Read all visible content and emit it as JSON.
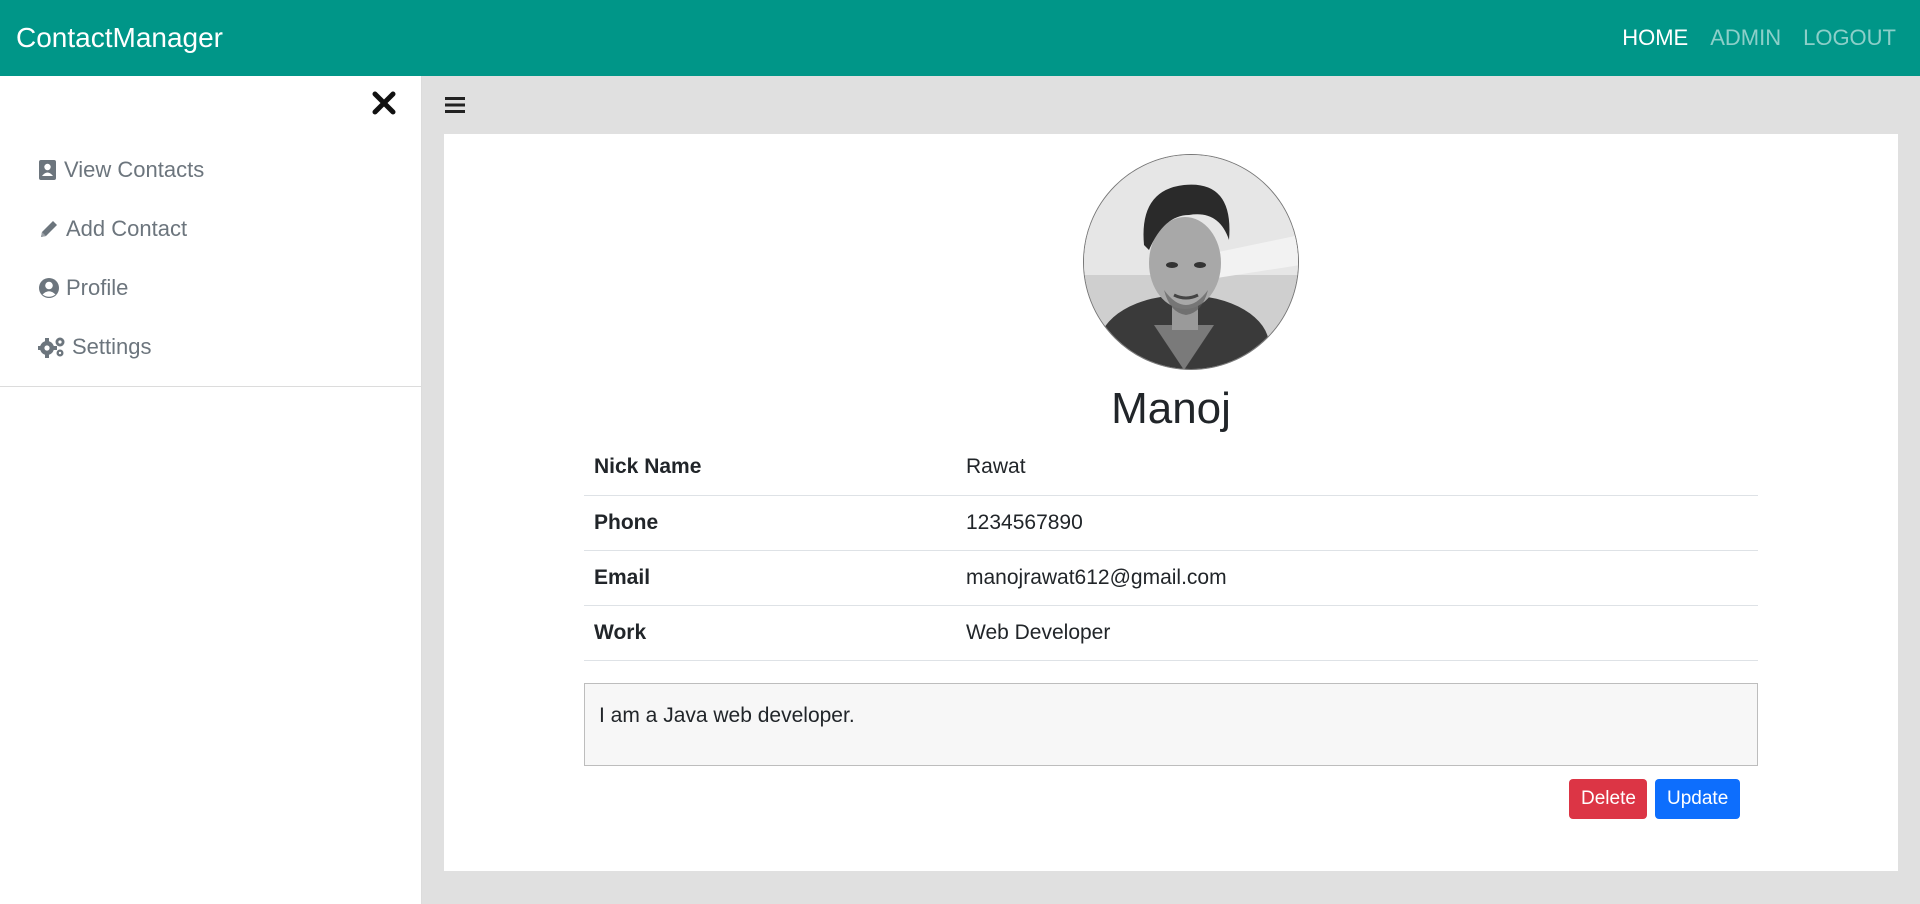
{
  "navbar": {
    "brand": "ContactManager",
    "links": [
      {
        "label": "HOME",
        "active": true
      },
      {
        "label": "ADMIN",
        "active": false
      },
      {
        "label": "LOGOUT",
        "active": false
      }
    ]
  },
  "sidebar": {
    "items": [
      {
        "label": "View Contacts",
        "icon": "address-book-icon"
      },
      {
        "label": "Add Contact",
        "icon": "pencil-icon"
      },
      {
        "label": "Profile",
        "icon": "user-circle-icon"
      },
      {
        "label": "Settings",
        "icon": "gears-icon"
      }
    ]
  },
  "contact": {
    "name": "Manoj",
    "fields": [
      {
        "label": "Nick Name",
        "value": "Rawat"
      },
      {
        "label": "Phone",
        "value": "1234567890"
      },
      {
        "label": "Email",
        "value": "manojrawat612@gmail.com"
      },
      {
        "label": "Work",
        "value": "Web Developer"
      }
    ],
    "description": "I am a Java web developer."
  },
  "actions": {
    "delete_label": "Delete",
    "update_label": "Update"
  },
  "colors": {
    "navbar": "#009688",
    "delete": "#dc3545",
    "update": "#0d6efd"
  }
}
